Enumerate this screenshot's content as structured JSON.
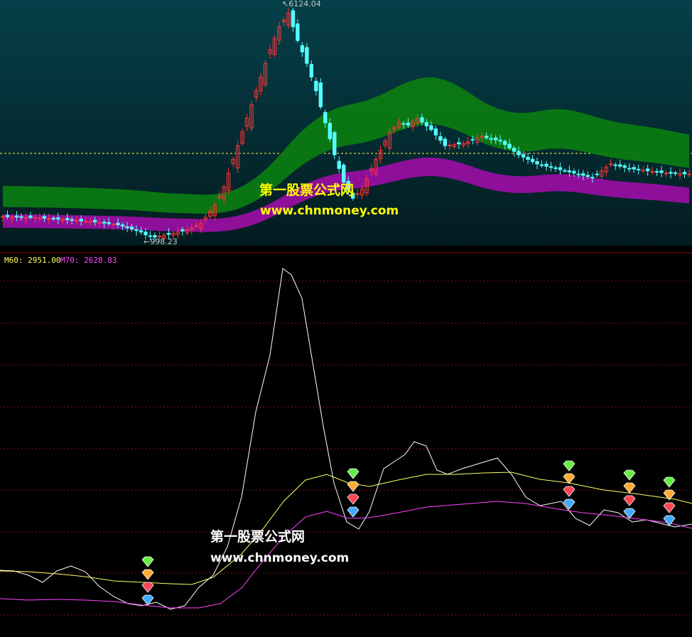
{
  "watermark": {
    "site_name": "第一股票公式网",
    "site_url": "www.chnmoney.com"
  },
  "price_panel": {
    "high_label": "6124.04",
    "low_label": "998.23",
    "high_marker": "↖",
    "low_marker": "←"
  },
  "indicator_panel": {
    "legend": [
      {
        "name": "M60",
        "value": "2951.00",
        "color": "#ffff66"
      },
      {
        "name": "M70",
        "value": "2628.83",
        "color": "#ff44ff"
      }
    ]
  },
  "colors": {
    "up_candle": "#ff3333",
    "down_candle": "#54ffff",
    "green_band": "#0b7a12",
    "purple_band": "#8e0f9a",
    "panel_top_bg": "#05313a",
    "grid": "#7a1212",
    "main_line": "#ffffff",
    "m60_line": "#ffff66",
    "m70_line": "#ff44ff",
    "gem_colors": [
      "#66ee44",
      "#ffaa33",
      "#ff4455",
      "#44aaff"
    ]
  },
  "chart_data": [
    {
      "type": "candlestick",
      "title": "",
      "x_count": 150,
      "y_range": [
        998.23,
        6124.04
      ],
      "annotations": [
        "6124.04",
        "998.23"
      ],
      "bands": [
        "green long moving-average ribbon",
        "purple long moving-average ribbon"
      ],
      "close_path": [
        [
          0,
          1450
        ],
        [
          8,
          1420
        ],
        [
          14,
          1380
        ],
        [
          20,
          1330
        ],
        [
          25,
          1270
        ],
        [
          30,
          1110
        ],
        [
          31,
          1050
        ],
        [
          33,
          1000
        ],
        [
          36,
          1060
        ],
        [
          40,
          1160
        ],
        [
          43,
          1300
        ],
        [
          46,
          1700
        ],
        [
          48,
          2100
        ],
        [
          50,
          2700
        ],
        [
          52,
          3300
        ],
        [
          54,
          3900
        ],
        [
          56,
          4500
        ],
        [
          58,
          5100
        ],
        [
          60,
          5600
        ],
        [
          62,
          5900
        ],
        [
          64,
          5300
        ],
        [
          66,
          4800
        ],
        [
          68,
          4200
        ],
        [
          70,
          3500
        ],
        [
          72,
          2800
        ],
        [
          74,
          2200
        ],
        [
          76,
          1850
        ],
        [
          78,
          2050
        ],
        [
          80,
          2500
        ],
        [
          82,
          2900
        ],
        [
          84,
          3300
        ],
        [
          86,
          3500
        ],
        [
          88,
          3450
        ],
        [
          90,
          3600
        ],
        [
          93,
          3350
        ],
        [
          96,
          3000
        ],
        [
          100,
          3050
        ],
        [
          104,
          3200
        ],
        [
          108,
          3100
        ],
        [
          112,
          2800
        ],
        [
          116,
          2600
        ],
        [
          120,
          2500
        ],
        [
          124,
          2400
        ],
        [
          128,
          2300
        ],
        [
          132,
          2600
        ],
        [
          136,
          2500
        ],
        [
          140,
          2450
        ],
        [
          144,
          2400
        ],
        [
          149,
          2380
        ]
      ]
    },
    {
      "type": "line",
      "title": "",
      "series": [
        {
          "name": "M60",
          "values": [
            2951.0
          ]
        },
        {
          "name": "M70",
          "values": [
            2628.83
          ]
        }
      ],
      "grid": true,
      "markers": "diamond signal icons at bottoms"
    }
  ]
}
